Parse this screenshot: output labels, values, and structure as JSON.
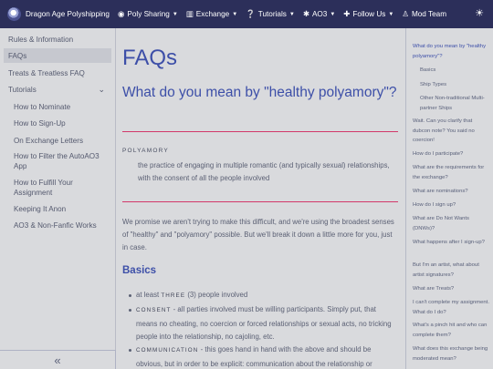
{
  "topbar": {
    "brand": "Dragon Age Polyshipping",
    "nav": [
      {
        "icon": "users-icon",
        "glyph": "●",
        "label": "Poly Sharing"
      },
      {
        "icon": "building-icon",
        "glyph": "▥",
        "label": "Exchange"
      },
      {
        "icon": "question-icon",
        "glyph": "ⓘ",
        "label": "Tutorials"
      },
      {
        "icon": "ao3-icon",
        "glyph": "✱",
        "label": "AO3"
      },
      {
        "icon": "user-plus-icon",
        "glyph": "✚",
        "label": "Follow Us"
      },
      {
        "icon": "team-icon",
        "glyph": "⚉",
        "label": "Mod Team"
      }
    ]
  },
  "sidebar": {
    "items": [
      "Rules & Information",
      "FAQs",
      "Treats & Treatless FAQ",
      "Tutorials"
    ],
    "sub_items": [
      "How to Nominate",
      "How to Sign-Up",
      "On Exchange Letters",
      "How to Filter the AutoAO3 App",
      "How to Fulfill Your Assignment",
      "Keeping It Anon",
      "AO3 & Non-Fanfic Works"
    ]
  },
  "main": {
    "title": "FAQs",
    "question": "What do you mean by \"healthy polyamory\"?",
    "term": "POLYAMORY",
    "definition": "the practice of engaging in multiple romantic (and typically sexual) relationships, with the consent of all the people involved",
    "intro": "We promise we aren't trying to make this difficult, and we're using the broadest senses of \"healthy\" and \"polyamory\" possible. But we'll break it down a little more for you, just in case.",
    "basics_heading": "Basics",
    "bullets": [
      {
        "prefix": "at least ",
        "sc": "THREE",
        "text": " (3) people involved"
      },
      {
        "prefix": "",
        "sc": "CONSENT",
        "text": " - all parties involved must be willing participants. Simply put, that means no cheating, no coercion or forced relationships or sexual acts, no tricking people into the relationship, no cajoling, etc."
      },
      {
        "prefix": "",
        "sc": "COMMUNICATION",
        "text": " - this goes hand in hand with the above and should be obvious, but in order to be explicit: communication about the relationship or"
      }
    ]
  },
  "toc": [
    "What do you mean by \"healthy polyamory\"?",
    "Basics",
    "Ship Types",
    "Other Non-traditional Multi-partner Ships",
    "Wait. Can you clarify that dubcon note? You said no coercion!",
    "How do I participate?",
    "What are the requirements for the exchange?",
    "What are nominations?",
    "How do I sign up?",
    "What are Do Not Wants (DNWs)?",
    "What happens after I sign-up?",
    "But I'm an artist, what about artist signatures?",
    "What are Treats?",
    "I can't complete my assignment. What do I do?",
    "What's a pinch hit and who can complete them?",
    "What does this exchange being moderated mean?"
  ]
}
